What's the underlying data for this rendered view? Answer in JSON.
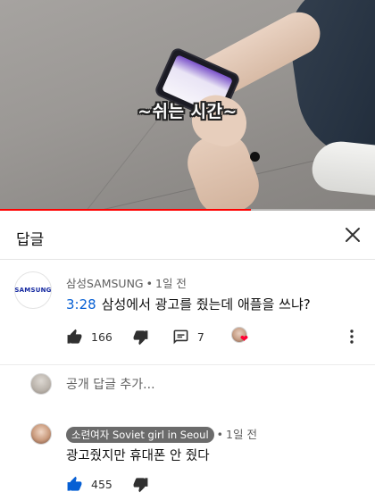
{
  "video": {
    "caption": "~쉬는 시간~",
    "progress_fraction": 0.67
  },
  "panel": {
    "title": "답글",
    "close_icon": "close-icon"
  },
  "parent_comment": {
    "author": "삼성SAMSUNG",
    "time": "1일 전",
    "avatar_text": "SAMSUNG",
    "timestamp_link": "3:28",
    "text": "삼성에서 광고를 줬는데 애플을 쓰냐?",
    "likes": "166",
    "replies": "7",
    "icons": [
      "thumb-up-icon",
      "thumb-down-icon",
      "comment-icon",
      "creator-heart-icon",
      "more-vertical-icon"
    ],
    "link_color": "#065fd4",
    "heart_color": "#ff0033"
  },
  "reply_box": {
    "placeholder": "공개 답글 추가..."
  },
  "reply": {
    "author": "소련여자 Soviet girl in Seoul",
    "time": "1일 전",
    "text": "광고줬지만 휴대폰 안 줬다",
    "likes": "455",
    "liked": true
  }
}
